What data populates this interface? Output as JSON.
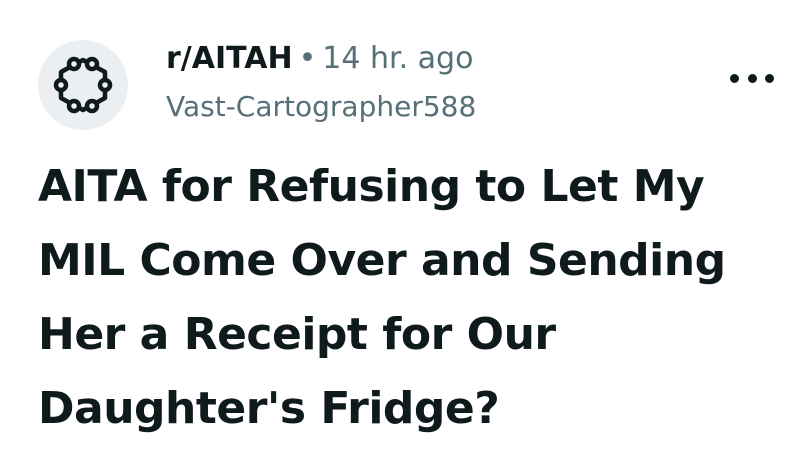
{
  "post": {
    "subreddit": "r/AITAH",
    "separator": "•",
    "time_ago": "14 hr. ago",
    "author": "Vast-Cartographer588",
    "title": "AITA for Refusing to Let My MIL Come Over and Sending Her a Receipt for Our Daughter's Fridge?"
  },
  "icons": {
    "avatar": "subreddit-network-icon",
    "menu": "more-options-icon"
  },
  "colors": {
    "text": "#0f1a1c",
    "muted": "#576f76",
    "avatar_bg": "#eceff1"
  }
}
